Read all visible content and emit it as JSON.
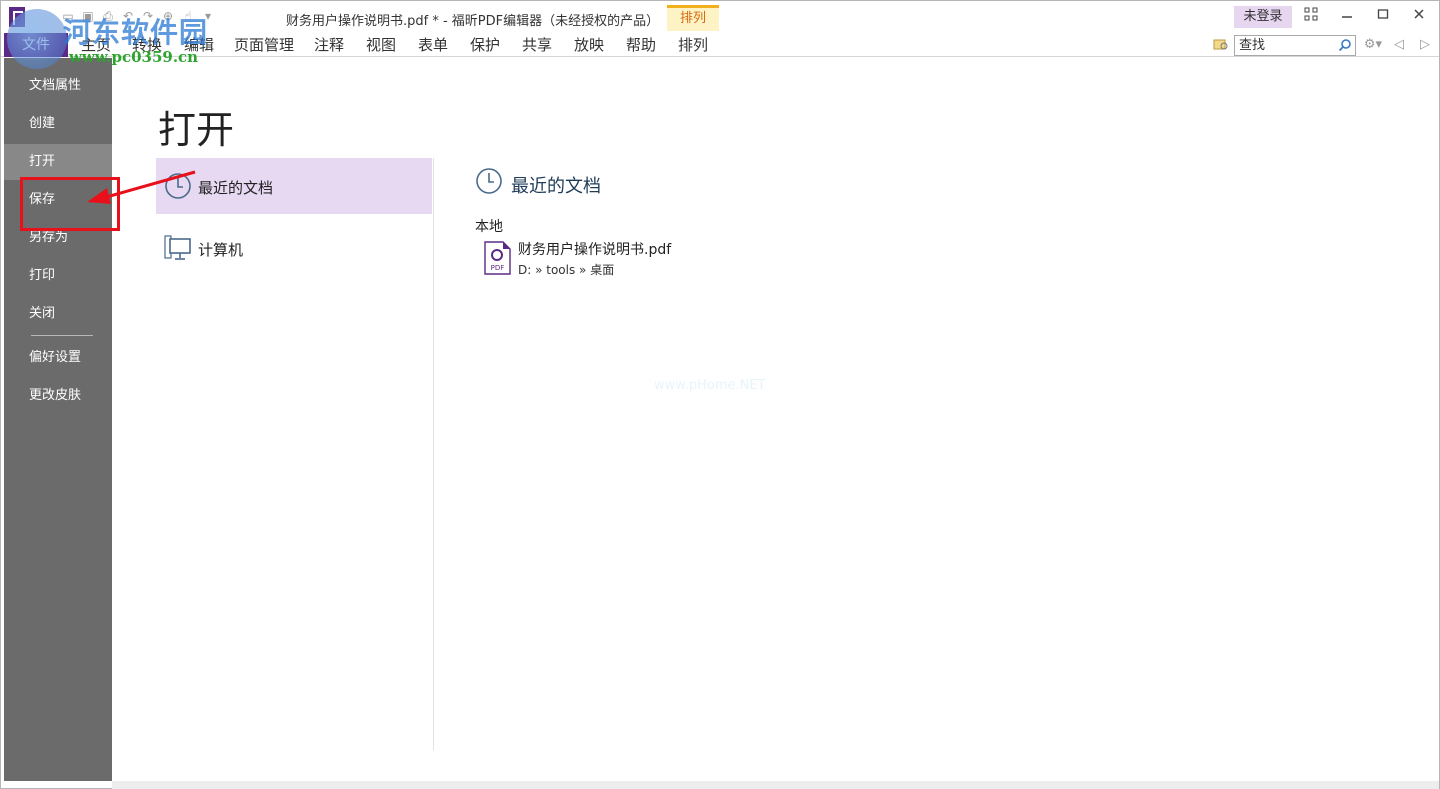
{
  "title_bar": {
    "window_title": "财务用户操作说明书.pdf * - 福昕PDF编辑器（未经授权的产品）",
    "context_tab_header": "排列",
    "login_label": "未登录",
    "window_buttons": [
      "▫▫",
      "—",
      "▢",
      "✕"
    ]
  },
  "ribbon": {
    "file_tab": "文件",
    "tabs": [
      "主页",
      "转换",
      "编辑",
      "页面管理",
      "注释",
      "视图",
      "表单",
      "保护",
      "共享",
      "放映",
      "帮助",
      "排列"
    ],
    "search": {
      "placeholder": "查找"
    }
  },
  "watermark": {
    "site_name": "河东软件园",
    "site_url": "www.pc0359.cn",
    "center_text": "www.pHome.NET"
  },
  "sidebar": {
    "items": [
      "文档属性",
      "创建",
      "打开",
      "保存",
      "另存为",
      "打印",
      "关闭",
      "偏好设置",
      "更改皮肤"
    ],
    "active_item": "打开"
  },
  "main": {
    "page_title": "打开",
    "options": [
      {
        "label": "最近的文档",
        "icon": "clock-icon",
        "active": true
      },
      {
        "label": "计算机",
        "icon": "computer-icon",
        "active": false
      }
    ],
    "section_title": "最近的文档",
    "group_label": "本地",
    "recent_files": [
      {
        "name": "财务用户操作说明书.pdf",
        "path": "D: » tools » 桌面",
        "icon": "pdf-file-icon"
      }
    ]
  },
  "colors": {
    "accent": "#5b2a86",
    "sidebar_bg": "#6b6b6b",
    "active_option_bg": "#e8d9f3",
    "context_tab_bg": "#fdf3c5",
    "annotation_red": "#e8101a"
  }
}
